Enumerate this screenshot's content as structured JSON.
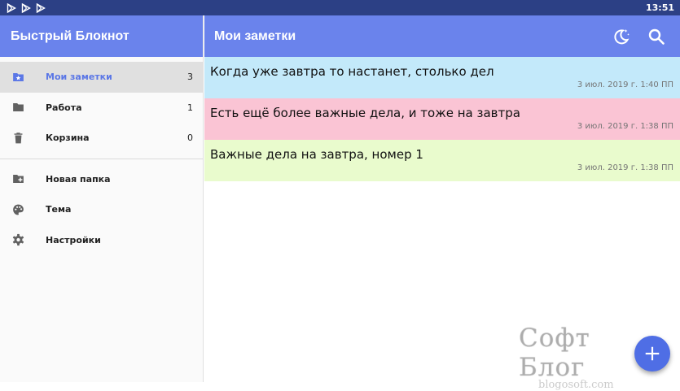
{
  "status_bar": {
    "time": "13:51",
    "icons": [
      "play-store-icon",
      "play-store-icon",
      "play-store-icon"
    ]
  },
  "drawer": {
    "title": "Быстрый Блокнот",
    "folders": [
      {
        "label": "Мои заметки",
        "count": "3",
        "icon": "notes-folder-icon",
        "active": true
      },
      {
        "label": "Работа",
        "count": "1",
        "icon": "folder-icon",
        "active": false
      },
      {
        "label": "Корзина",
        "count": "0",
        "icon": "trash-icon",
        "active": false
      }
    ],
    "actions": [
      {
        "label": "Новая папка",
        "icon": "new-folder-icon"
      },
      {
        "label": "Тема",
        "icon": "palette-icon"
      },
      {
        "label": "Настройки",
        "icon": "settings-gear-icon"
      }
    ]
  },
  "appbar": {
    "title": "Мои заметки",
    "actions": [
      "night-mode-icon",
      "search-icon"
    ]
  },
  "notes": [
    {
      "text": "Когда уже завтра то настанет, столько дел",
      "date": "3 июл. 2019 г. 1:40 ПП",
      "color": "#c3e9fa"
    },
    {
      "text": "Есть ещё более важные дела, и тоже на завтра",
      "date": "3 июл. 2019 г. 1:38 ПП",
      "color": "#fac4d4"
    },
    {
      "text": "Важные дела на завтра, номер 1",
      "date": "3 июл. 2019 г. 1:38 ПП",
      "color": "#e9fbcd"
    }
  ],
  "watermark": {
    "title": "Софт Блог",
    "subtitle": "blogosoft.com"
  },
  "fab": {
    "icon": "add-icon"
  },
  "colors": {
    "primary": "#6a83ec",
    "status_bar": "#2c4085",
    "accent": "#4f6ee5",
    "active_label": "#5b77e6"
  }
}
